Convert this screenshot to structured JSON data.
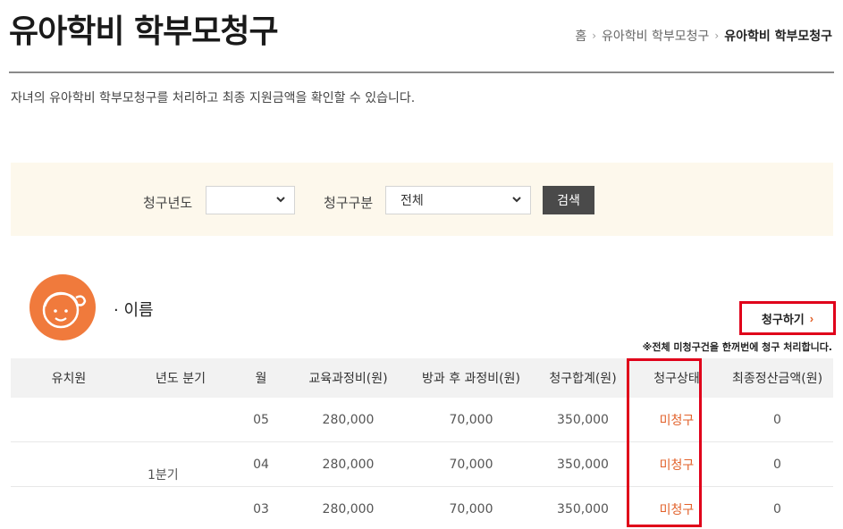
{
  "header": {
    "title": "유아학비 학부모청구",
    "breadcrumb": [
      "홈",
      "유아학비 학부모청구",
      "유아학비 학부모청구"
    ],
    "description": "자녀의 유아학비 학부모청구를 처리하고 최종 지원금액을 확인할 수 있습니다."
  },
  "search": {
    "year_label": "청구년도",
    "year_value": "",
    "type_label": "청구구분",
    "type_value": "전체",
    "button_label": "검색"
  },
  "child": {
    "name_label": "· 이름"
  },
  "claim": {
    "button_label": "청구하기",
    "note": "※전체 미청구건을 한꺼번에 청구 처리합니다."
  },
  "table": {
    "headers": [
      "유치원",
      "년도 분기",
      "월",
      "교육과정비(원)",
      "방과 후 과정비(원)",
      "청구합계(원)",
      "청구상태",
      "최종정산금액(원)"
    ],
    "quarter": "1분기",
    "rows": [
      {
        "month": "05",
        "edu": "280,000",
        "after": "70,000",
        "total": "350,000",
        "status": "미청구",
        "final": "0"
      },
      {
        "month": "04",
        "edu": "280,000",
        "after": "70,000",
        "total": "350,000",
        "status": "미청구",
        "final": "0"
      },
      {
        "month": "03",
        "edu": "280,000",
        "after": "70,000",
        "total": "350,000",
        "status": "미청구",
        "final": "0"
      }
    ]
  },
  "colors": {
    "accent_orange": "#e2612a",
    "highlight_red": "#e0001a",
    "search_bg": "#fdf8ec",
    "avatar_bg": "#f07a3c"
  }
}
